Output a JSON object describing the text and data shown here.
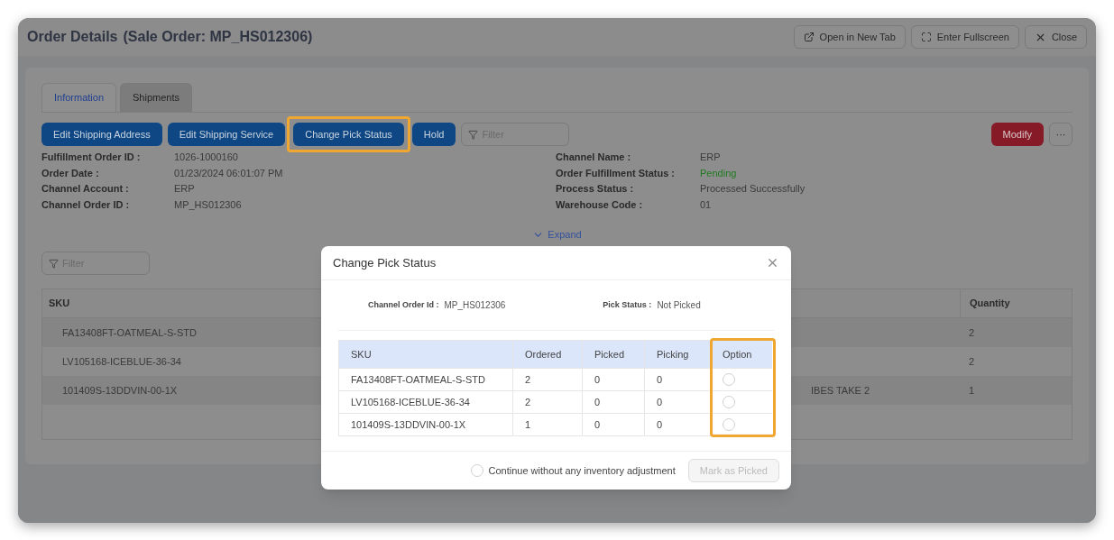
{
  "window": {
    "title": "Order Details",
    "subtitle": "(Sale Order: MP_HS012306)",
    "actions": [
      {
        "kind": "external",
        "label": "Open in New Tab"
      },
      {
        "kind": "fullscreen",
        "label": "Enter Fullscreen"
      },
      {
        "kind": "close",
        "label": "Close"
      }
    ]
  },
  "tabs": [
    {
      "label": "Information",
      "selected": true
    },
    {
      "label": "Shipments",
      "selected": false
    }
  ],
  "toolbar": {
    "buttons": [
      {
        "label": "Edit Shipping Address",
        "highlighted": false
      },
      {
        "label": "Edit Shipping Service",
        "highlighted": false
      },
      {
        "label": "Change Pick Status",
        "highlighted": true
      },
      {
        "label": "Hold",
        "highlighted": false
      }
    ],
    "filter_placeholder": "Filter",
    "modify": "Modify",
    "more": "···"
  },
  "details_left": [
    {
      "label": "Fulfillment Order ID :",
      "value": "1026-1000160"
    },
    {
      "label": "Order Date :",
      "value": "01/23/2024 06:01:07 PM"
    },
    {
      "label": "Channel Account :",
      "value": "ERP"
    },
    {
      "label": "Channel Order ID :",
      "value": "MP_HS012306"
    }
  ],
  "details_right": [
    {
      "label": "Channel Name :",
      "value": "ERP",
      "kind": "plain"
    },
    {
      "label": "Order Fulfillment Status :",
      "value": "Pending",
      "kind": "status"
    },
    {
      "label": "Process Status :",
      "value": "Processed Successfully",
      "kind": "plain"
    },
    {
      "label": "Warehouse Code :",
      "value": "01",
      "kind": "plain"
    }
  ],
  "expand": "Expand",
  "items": {
    "filter_placeholder": "Filter",
    "columns": [
      "SKU",
      "Quantity"
    ],
    "rows": [
      {
        "sku": "FA13408FT-OATMEAL-S-STD",
        "column_2": "",
        "quantity": "2"
      },
      {
        "sku": "LV105168-ICEBLUE-36-34",
        "column_2": "",
        "quantity": "2"
      },
      {
        "sku": "101409S-13DDVIN-00-1X",
        "column_2": "IBES TAKE 2",
        "quantity": "1"
      }
    ]
  },
  "dialog": {
    "title": "Change Pick Status",
    "channel_order_label": "Channel Order Id :",
    "channel_order_value": "MP_HS012306",
    "pick_status_label": "Pick Status :",
    "pick_status_value": "Not Picked",
    "columns": [
      "SKU",
      "Ordered",
      "Picked",
      "Picking",
      "Option"
    ],
    "option_highlighted": true,
    "rows": [
      {
        "sku": "FA13408FT-OATMEAL-S-STD",
        "ordered": "2",
        "picked": "0",
        "picking": "0",
        "selected": false
      },
      {
        "sku": "LV105168-ICEBLUE-36-34",
        "ordered": "2",
        "picked": "0",
        "picking": "0",
        "selected": false
      },
      {
        "sku": "101409S-13DDVIN-00-1X",
        "ordered": "1",
        "picked": "0",
        "picking": "0",
        "selected": false
      }
    ],
    "continue": {
      "label": "Continue without any inventory adjustment",
      "checked": false
    },
    "submit": {
      "label": "Mark as Picked",
      "disabled": true
    }
  }
}
